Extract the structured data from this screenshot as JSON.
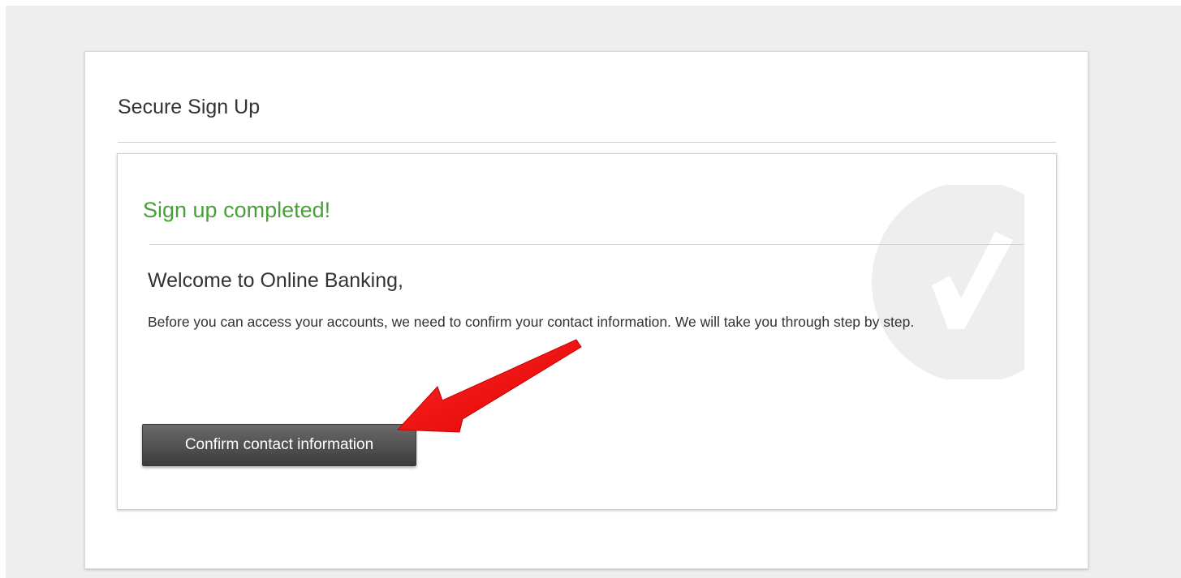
{
  "signup": {
    "title": "Secure Sign Up"
  },
  "confirmation": {
    "status": "Sign up completed!",
    "welcome": "Welcome to Online Banking,",
    "message": "Before you can access your accounts, we need to confirm your contact information. We will take you through step by step.",
    "button_label": "Confirm contact information"
  },
  "colors": {
    "page_background": "#eeeeee",
    "success_green": "#4a9f3a",
    "button_dark": "#3c3c3c",
    "annotation_red": "#ee1111",
    "watermark_grey": "#eeeeee"
  },
  "icons": {
    "watermark": "checkmark-circle-icon",
    "annotation": "red-arrow-icon"
  }
}
